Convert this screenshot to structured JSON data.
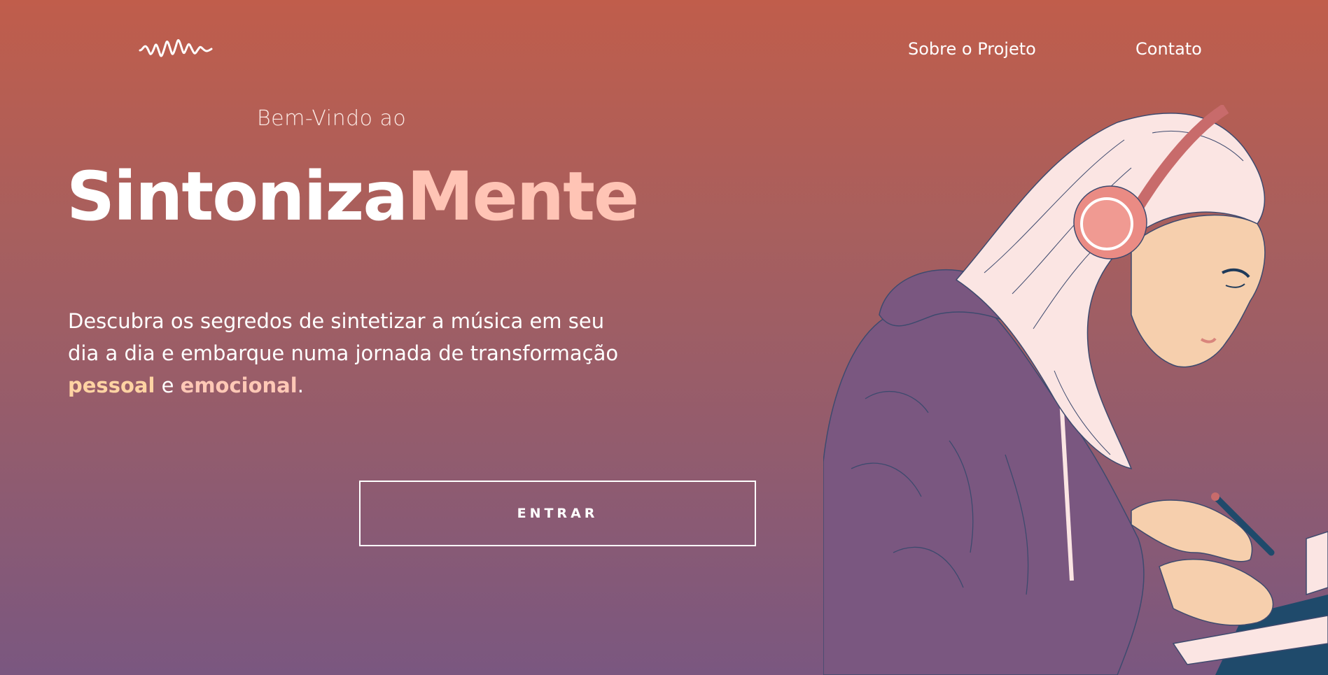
{
  "header": {
    "logo_icon": "soundwave-icon",
    "nav": [
      {
        "label": "Sobre o Projeto"
      },
      {
        "label": "Contato"
      }
    ]
  },
  "hero": {
    "welcome": "Bem-Vindo ao",
    "brand_part1": "Sintoniza",
    "brand_part2": "Mente",
    "description_start": "Descubra os segredos de sintetizar a música em seu dia a dia e embarque numa jornada de transformação ",
    "highlight_1": "pessoal",
    "connector": " e ",
    "highlight_2": "emocional",
    "description_end": ".",
    "button_label": "ENTRAR"
  },
  "illustration": {
    "icon": "girl-with-headphones-writing-illustration"
  },
  "colors": {
    "gradient_top": "#c05d4b",
    "gradient_bottom": "#7a5780",
    "brand_accent": "#ffc4b5",
    "highlight_pessoal": "#ffd3a3",
    "highlight_emocional": "#ffc8b6",
    "hoodie": "#7a5780",
    "headphones": "#ea8b84",
    "skin": "#f6cfad",
    "hair": "#fbe5e3"
  }
}
